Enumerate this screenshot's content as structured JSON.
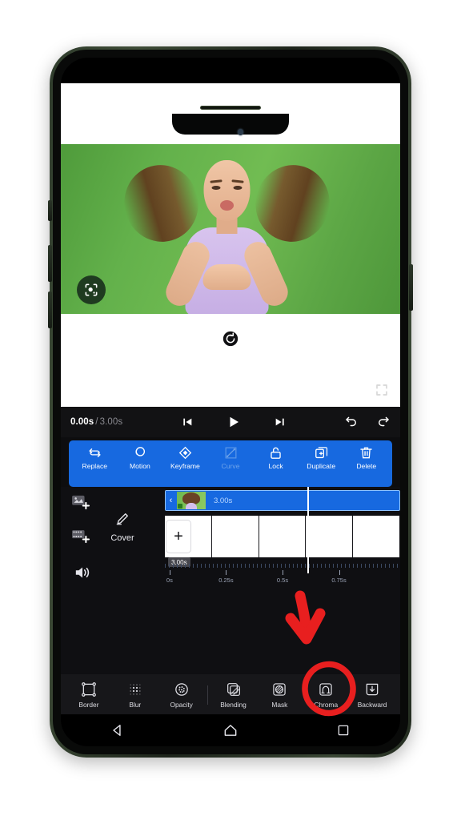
{
  "app": {
    "name": "video-editor"
  },
  "preview": {
    "lens_icon": "lens-scan-icon",
    "rotate_icon": "rotate-icon",
    "fullscreen_icon": "fullscreen-expand-icon",
    "background_color": "#63b14b",
    "subject_description": "woman blowing a kiss on green screen"
  },
  "transport": {
    "current_time": "0.00s",
    "separator": "/",
    "total_time": "3.00s",
    "prev_frame_icon": "skip-previous-icon",
    "play_icon": "play-icon",
    "next_frame_icon": "skip-next-icon",
    "undo_icon": "undo-icon",
    "redo_icon": "redo-icon"
  },
  "context_toolbar": {
    "accent_color": "#1769e0",
    "items": [
      {
        "label": "Replace",
        "icon": "replace-icon",
        "disabled": false
      },
      {
        "label": "Motion",
        "icon": "motion-icon",
        "disabled": false
      },
      {
        "label": "Keyframe",
        "icon": "keyframe-icon",
        "disabled": false
      },
      {
        "label": "Curve",
        "icon": "curve-icon",
        "disabled": true
      },
      {
        "label": "Lock",
        "icon": "unlock-icon",
        "disabled": false
      },
      {
        "label": "Duplicate",
        "icon": "duplicate-icon",
        "disabled": false
      },
      {
        "label": "Delete",
        "icon": "trash-icon",
        "disabled": false
      }
    ]
  },
  "timeline": {
    "track_icons": [
      {
        "name": "add-image-icon"
      },
      {
        "name": "add-video-icon"
      },
      {
        "name": "audio-icon"
      }
    ],
    "cover": {
      "label": "Cover",
      "icon": "pen-icon"
    },
    "selected_clip": {
      "duration": "3.00s",
      "handle_icon": "chevron-left-icon",
      "selected": true
    },
    "media_track": {
      "add_label": "+",
      "duration_badge": "3.00s",
      "cell_count": 5
    },
    "ruler": {
      "labels": [
        "0s",
        "0.25s",
        "0.5s",
        "0.75s"
      ],
      "positions_pct": [
        2,
        26,
        50,
        74
      ]
    },
    "playhead_position_pct": 30
  },
  "effects_bar": {
    "items": [
      {
        "label": "Border",
        "icon": "border-icon",
        "highlighted": false
      },
      {
        "label": "Blur",
        "icon": "blur-icon",
        "highlighted": false
      },
      {
        "label": "Opacity",
        "icon": "opacity-icon",
        "highlighted": false
      },
      {
        "label": "Blending",
        "icon": "blending-icon",
        "highlighted": false
      },
      {
        "label": "Mask",
        "icon": "mask-icon",
        "highlighted": false
      },
      {
        "label": "Chroma",
        "icon": "chroma-icon",
        "highlighted": true
      },
      {
        "label": "Backward",
        "icon": "backward-icon",
        "highlighted": false
      }
    ]
  },
  "android_nav": {
    "back_icon": "back-triangle-icon",
    "home_icon": "home-icon",
    "recents_icon": "recents-square-icon"
  },
  "annotations": {
    "arrow_color": "#e81f1f",
    "circle_color": "#e81f1f",
    "arrow_target": "media-track-clip",
    "circle_target": "chroma-button"
  }
}
